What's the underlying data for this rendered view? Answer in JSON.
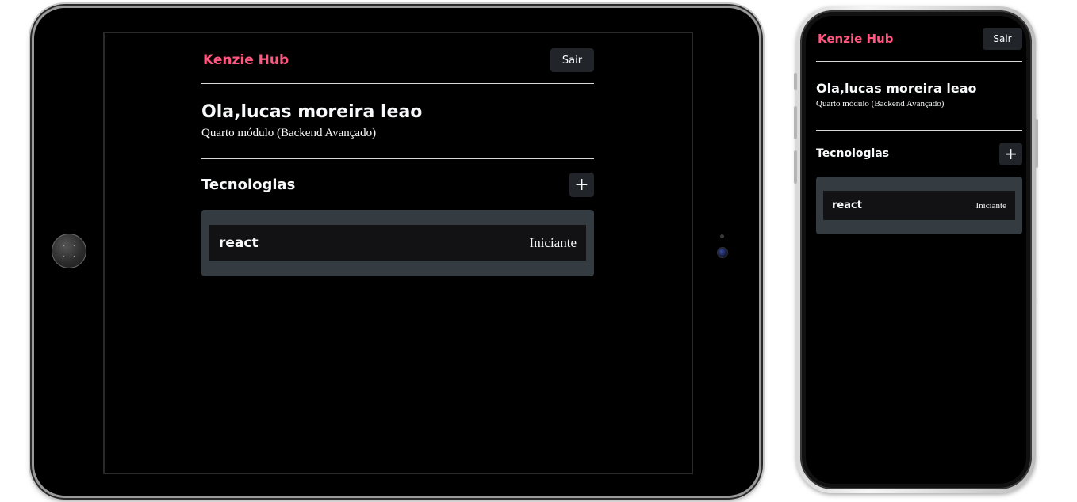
{
  "app": {
    "brand": "Kenzie Hub",
    "logout_label": "Sair",
    "greeting": "Ola,lucas moreira leao",
    "module": "Quarto módulo (Backend Avançado)",
    "technologies_title": "Tecnologias",
    "add_label": "+",
    "technologies": [
      {
        "name": "react",
        "status": "Iniciante"
      }
    ]
  },
  "colors": {
    "brand": "#ff577f",
    "background": "#000000",
    "button": "#212529",
    "list_background": "#343b41",
    "card_background": "#121214",
    "text": "#f8f9fa"
  }
}
